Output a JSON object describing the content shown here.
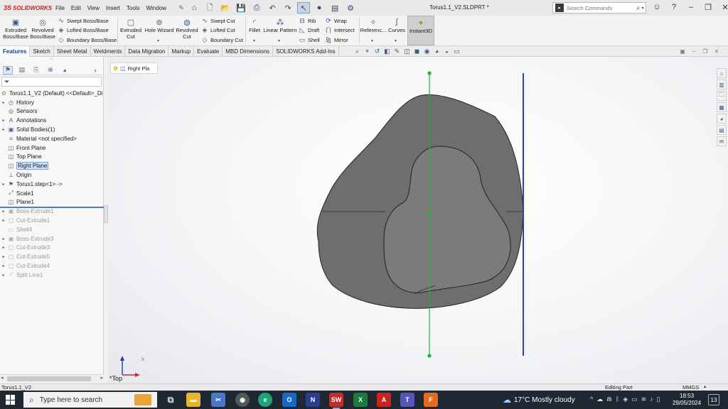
{
  "app": {
    "logo_text": "SOLIDWORKS",
    "menu": [
      "File",
      "Edit",
      "View",
      "Insert",
      "Tools",
      "Window"
    ],
    "document_title": "Torus1.1_V2.SLDPRT *",
    "search_placeholder": "Search Commands"
  },
  "commands": {
    "extruded_boss_base": "Extruded\nBoss/Base",
    "revolved_boss_base": "Revolved\nBoss/Base",
    "swept_boss_base": "Swept Boss/Base",
    "lofted_boss_base": "Lofted Boss/Base",
    "boundary_boss_base": "Boundary Boss/Base",
    "extruded_cut": "Extruded\nCut",
    "hole_wizard": "Hole Wizard",
    "revolved_cut": "Revolved\nCut",
    "swept_cut": "Swept Cut",
    "lofted_cut": "Lofted Cut",
    "boundary_cut": "Boundary Cut",
    "fillet": "Fillet",
    "linear_pattern": "Linear Pattern",
    "rib": "Rib",
    "draft": "Draft",
    "shell": "Shell",
    "wrap": "Wrap",
    "intersect": "Intersect",
    "mirror": "Mirror",
    "reference": "Referenc...",
    "curves": "Curves",
    "instant3d": "Instant3D"
  },
  "tabs": [
    "Features",
    "Sketch",
    "Sheet Metal",
    "Weldments",
    "Data Migration",
    "Markup",
    "Evaluate",
    "MBD Dimensions",
    "SOLIDWORKS Add-Ins"
  ],
  "active_tab": "Features",
  "tree": {
    "root": "Torus1.1_V2 (Default) <<Default>_Di",
    "items": [
      {
        "label": "History",
        "icon": "history-icon",
        "expandable": true,
        "state": "normal"
      },
      {
        "label": "Sensors",
        "icon": "sensor-icon",
        "expandable": false,
        "state": "normal"
      },
      {
        "label": "Annotations",
        "icon": "annotation-icon",
        "expandable": true,
        "state": "normal"
      },
      {
        "label": "Solid Bodies(1)",
        "icon": "solid-bodies-icon",
        "expandable": true,
        "state": "normal"
      },
      {
        "label": "Material <not specified>",
        "icon": "material-icon",
        "expandable": false,
        "state": "normal"
      },
      {
        "label": "Front Plane",
        "icon": "plane-icon",
        "expandable": false,
        "state": "normal"
      },
      {
        "label": "Top Plane",
        "icon": "plane-icon",
        "expandable": false,
        "state": "normal"
      },
      {
        "label": "Right Plane",
        "icon": "plane-icon",
        "expandable": false,
        "state": "selected"
      },
      {
        "label": "Origin",
        "icon": "origin-icon",
        "expandable": false,
        "state": "normal"
      },
      {
        "label": "Torus1.step<1> ->",
        "icon": "imported-part-icon",
        "expandable": true,
        "state": "normal"
      },
      {
        "label": "Scale1",
        "icon": "scale-icon",
        "expandable": false,
        "state": "normal"
      },
      {
        "label": "Plane1",
        "icon": "plane-icon",
        "expandable": false,
        "state": "normal"
      },
      {
        "label": "Boss-Extrude1",
        "icon": "extrude-icon",
        "expandable": true,
        "state": "suppressed"
      },
      {
        "label": "Cut-Extrude1",
        "icon": "cut-icon",
        "expandable": true,
        "state": "suppressed"
      },
      {
        "label": "Shell4",
        "icon": "shell-icon",
        "expandable": false,
        "state": "suppressed"
      },
      {
        "label": "Boss-Extrude3",
        "icon": "extrude-icon",
        "expandable": true,
        "state": "suppressed"
      },
      {
        "label": "Cut-Extrude3",
        "icon": "cut-icon",
        "expandable": true,
        "state": "suppressed"
      },
      {
        "label": "Cut-Extrude5",
        "icon": "cut-icon",
        "expandable": true,
        "state": "suppressed"
      },
      {
        "label": "Cut-Extrude4",
        "icon": "cut-icon",
        "expandable": true,
        "state": "suppressed"
      },
      {
        "label": "Split Line1",
        "icon": "split-line-icon",
        "expandable": true,
        "state": "suppressed"
      }
    ]
  },
  "viewport": {
    "breadcrumb_label": "Right Pla",
    "view_name": "*Top",
    "axis_x": "X",
    "colors": {
      "body": "#6e6e6e",
      "face": "#7b7b7b",
      "green_line": "#22b43a",
      "blue_line": "#2f3fb5"
    }
  },
  "status": {
    "filename": "Torus1.1_V2",
    "mode": "Editing Part",
    "units": "MMGS"
  },
  "taskbar": {
    "search_text": "Type here to search",
    "weather": "17°C  Mostly cloudy",
    "time": "18:53",
    "date": "29/05/2024",
    "notification_count": "13"
  }
}
